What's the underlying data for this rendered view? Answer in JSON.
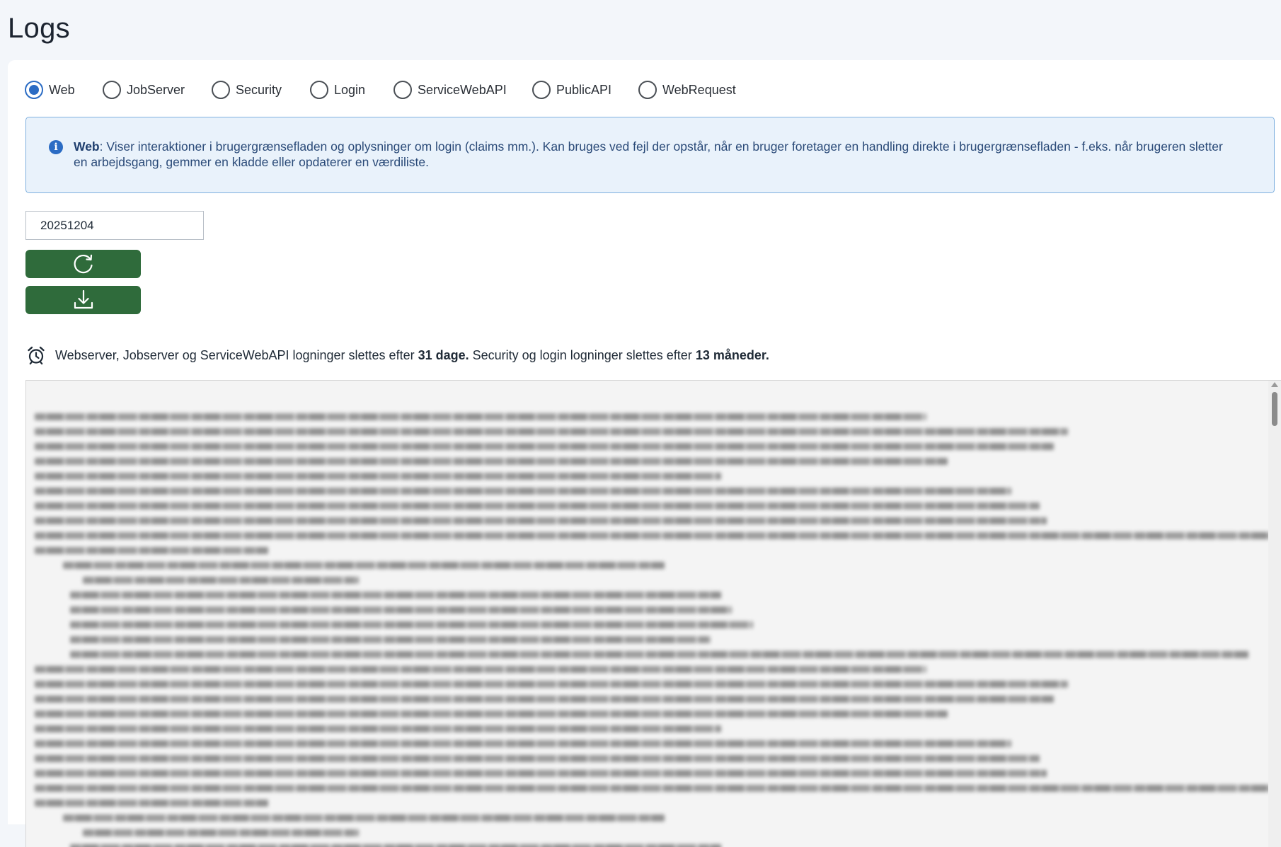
{
  "page": {
    "title": "Logs"
  },
  "log_types": {
    "selected": "Web",
    "options": [
      {
        "label": "Web",
        "selected": true
      },
      {
        "label": "JobServer",
        "selected": false
      },
      {
        "label": "Security",
        "selected": false
      },
      {
        "label": "Login",
        "selected": false
      },
      {
        "label": "ServiceWebAPI",
        "selected": false
      },
      {
        "label": "PublicAPI",
        "selected": false
      },
      {
        "label": "WebRequest",
        "selected": false
      }
    ]
  },
  "info": {
    "icon": "info-circle-icon",
    "heading": "Web",
    "text": ": Viser interaktioner i brugergrænsefladen og oplysninger om login (claims mm.). Kan bruges ved fejl der opstår, når en bruger foretager en handling direkte i brugergrænsefladen - f.eks. når brugeren sletter en arbejdsgang, gemmer en kladde eller opdaterer en værdiliste."
  },
  "date_field": {
    "value": "20251204"
  },
  "actions": {
    "refresh_icon": "refresh-icon",
    "download_icon": "download-icon",
    "button_color": "#2f6b3b"
  },
  "retention": {
    "icon": "alarm-clock-icon",
    "prefix": "Webserver, Jobserver og ServiceWebAPI logninger slettes efter ",
    "days": "31 dage.",
    "middle": " Security og login logninger slettes efter ",
    "months": "13 måneder."
  },
  "colors": {
    "accent": "#2b6cc4",
    "info_background": "#e9f2fb",
    "info_border": "#7fb0df",
    "button": "#2f6b3b"
  }
}
